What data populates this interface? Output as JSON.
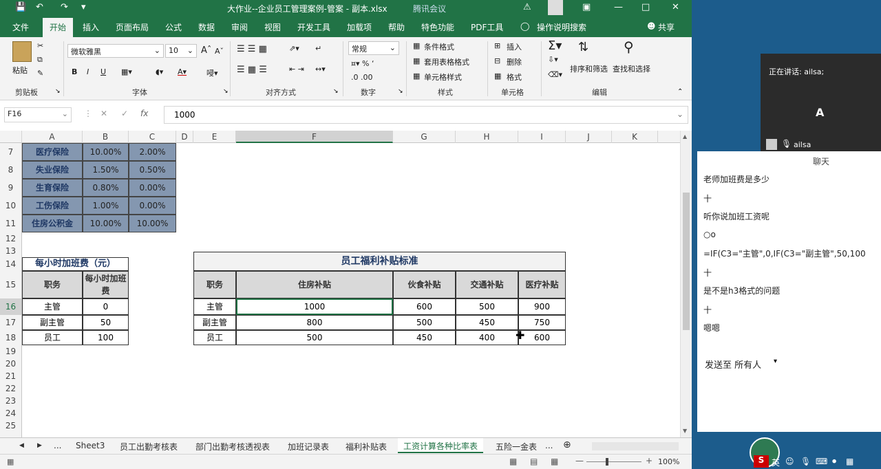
{
  "window": {
    "title": "大作业--企业员工管理案例-管案 - 副本.xlsx",
    "overlay_text": "腾讯会议"
  },
  "tabs": [
    "文件",
    "开始",
    "插入",
    "页面布局",
    "公式",
    "数据",
    "审阅",
    "视图",
    "开发工具",
    "加载项",
    "帮助",
    "特色功能",
    "PDF工具",
    "操作说明搜索"
  ],
  "share_label": "共享",
  "ribbon": {
    "clipboard": {
      "paste": "粘贴",
      "group": "剪贴板"
    },
    "font": {
      "name": "微软雅黑",
      "size": "10",
      "bold": "B",
      "italic": "I",
      "underline": "U",
      "group": "字体"
    },
    "align": {
      "group": "对齐方式"
    },
    "number": {
      "format": "常规",
      "group": "数字"
    },
    "styles": {
      "cond": "条件格式",
      "table": "套用表格格式",
      "cell": "单元格样式",
      "group": "样式"
    },
    "cells": {
      "insert": "插入",
      "delete": "删除",
      "format": "格式",
      "group": "单元格"
    },
    "editing": {
      "sort": "排序和筛选",
      "find": "查找和选择",
      "group": "编辑"
    }
  },
  "formula_bar": {
    "name_box": "F16",
    "value": "1000",
    "fx": "fx"
  },
  "columns": [
    "A",
    "B",
    "C",
    "D",
    "E",
    "F",
    "G",
    "H",
    "I",
    "J",
    "K"
  ],
  "rows": [
    "7",
    "8",
    "9",
    "10",
    "11",
    "12",
    "13",
    "14",
    "15",
    "16",
    "17",
    "18",
    "19",
    "20",
    "21",
    "22",
    "23",
    "24",
    "25"
  ],
  "insurance": [
    {
      "name": "医疗保险",
      "b": "10.00%",
      "c": "2.00%"
    },
    {
      "name": "失业保险",
      "b": "1.50%",
      "c": "0.50%"
    },
    {
      "name": "生育保险",
      "b": "0.80%",
      "c": "0.00%"
    },
    {
      "name": "工伤保险",
      "b": "1.00%",
      "c": "0.00%"
    },
    {
      "name": "住房公积金",
      "b": "10.00%",
      "c": "10.00%"
    }
  ],
  "overtime": {
    "title": "每小时加班费（元）",
    "headers": [
      "职务",
      "每小时加班费"
    ],
    "rows": [
      [
        "主管",
        "0"
      ],
      [
        "副主管",
        "50"
      ],
      [
        "员工",
        "100"
      ]
    ]
  },
  "welfare": {
    "title": "员工福利补贴标准",
    "headers": [
      "职务",
      "住房补贴",
      "伙食补贴",
      "交通补贴",
      "医疗补贴"
    ],
    "rows": [
      [
        "主管",
        "1000",
        "600",
        "500",
        "900"
      ],
      [
        "副主管",
        "800",
        "500",
        "450",
        "750"
      ],
      [
        "员工",
        "500",
        "450",
        "400",
        "600"
      ]
    ]
  },
  "sheet_tabs": [
    "...",
    "Sheet3",
    "员工出勤考核表",
    "部门出勤考核透视表",
    "加班记录表",
    "福利补贴表",
    "工资计算各种比率表",
    "五险一金表"
  ],
  "active_sheet": "工资计算各种比率表",
  "zoom": "100%",
  "meeting": {
    "speaking": "正在讲话: ailsa;",
    "avatar": "A",
    "user": "ailsa",
    "chat_title": "聊天",
    "messages": [
      "老师加班费是多少",
      "十",
      "听你说加班工资呢",
      "○o",
      "=IF(C3=\"主管\",0,IF(C3=\"副主管\",50,100",
      "十",
      "是不是h3格式的问题",
      "十",
      "嗯嗯"
    ],
    "send_to": "发送至 所有人",
    "ime": "英"
  }
}
